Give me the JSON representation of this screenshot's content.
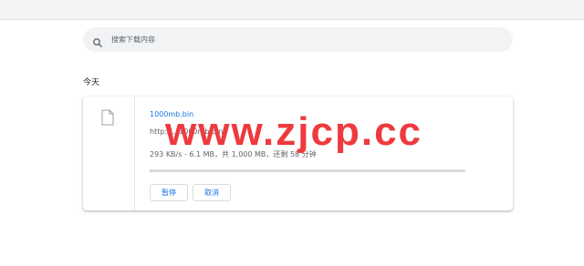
{
  "search": {
    "placeholder": "搜索下载内容",
    "icon": "search-icon"
  },
  "section": {
    "label": "今天"
  },
  "download": {
    "file_name": "1000mb.bin",
    "url": "http://...1000mb.bin",
    "status": "293 KB/s - 6.1 MB，共 1,000 MB，还剩 58 分钟",
    "progress_percent": 0.6,
    "icon": "file-icon",
    "pause_label": "暂停",
    "cancel_label": "取消"
  },
  "watermark": {
    "text": "www.zjcp.cc",
    "color": "#ee3a3f"
  },
  "colors": {
    "link": "#1a73e8",
    "search_bg": "#f1f3f4"
  }
}
